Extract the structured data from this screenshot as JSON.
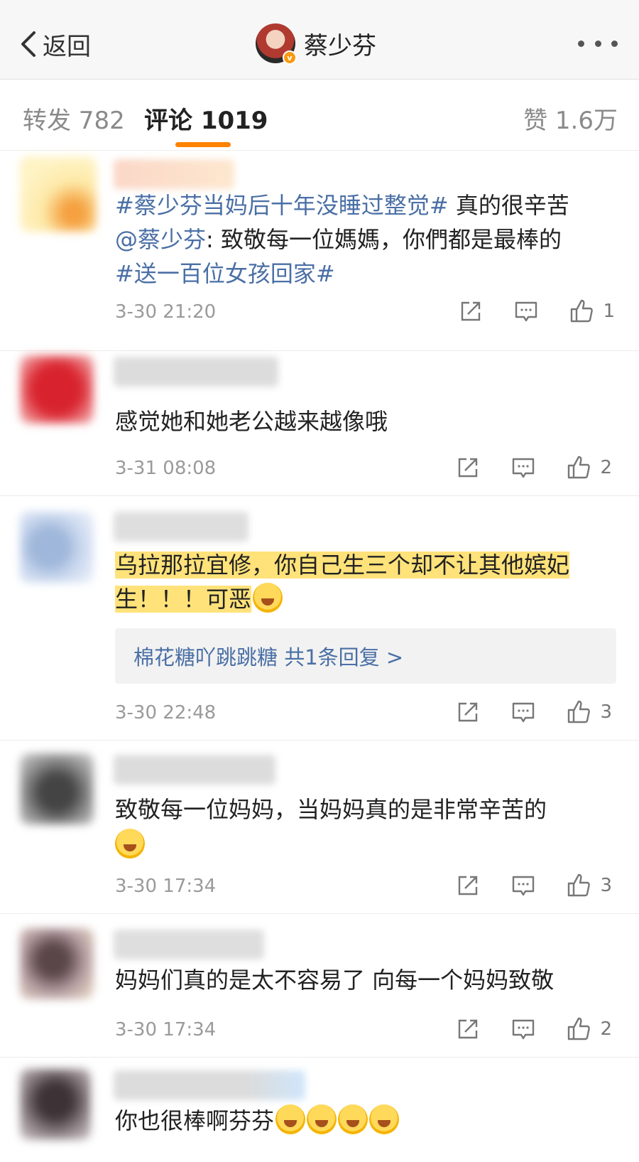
{
  "header": {
    "back_label": "返回",
    "title": "蔡少芬"
  },
  "tabs": {
    "repost": "转发 782",
    "comment": "评论 1019",
    "like": "赞 1.6万"
  },
  "comments": [
    {
      "segments": [
        {
          "text": "#蔡少芬当妈后十年没睡过整觉#",
          "style": "tag"
        },
        {
          "text": " 真的很辛苦",
          "style": "plain"
        }
      ],
      "segments2": [
        {
          "text": "@蔡少芬",
          "style": "tag"
        },
        {
          "text": ": 致敬每一位媽媽，你們都是最棒的",
          "style": "plain"
        }
      ],
      "segments3": [
        {
          "text": "#送一百位女孩回家#",
          "style": "tag"
        }
      ],
      "time": "3-30 21:20",
      "likes": "1"
    },
    {
      "text": "感觉她和她老公越来越像哦",
      "time": "3-31 08:08",
      "likes": "2"
    },
    {
      "line1": "乌拉那拉宜修，你自己生三个却不让其他嫔妃",
      "line2": "生！！！可恶",
      "reply_text": "棉花糖吖跳跳糖 共1条回复 >",
      "time": "3-30 22:48",
      "likes": "3"
    },
    {
      "text": "致敬每一位妈妈，当妈妈真的是非常辛苦的",
      "time": "3-30 17:34",
      "likes": "3"
    },
    {
      "text": "妈妈们真的是太不容易了 向每一个妈妈致敬",
      "time": "3-30 17:34",
      "likes": "2"
    },
    {
      "text": "你也很棒啊芬芬"
    }
  ],
  "colors": {
    "accent": "#ff8200",
    "link": "#4a6fa5",
    "highlight": "#ffe27a"
  },
  "icons": [
    "chevron-left-icon",
    "more-icon",
    "share-icon",
    "comment-icon",
    "thumbs-up-icon",
    "emoji-icon"
  ]
}
